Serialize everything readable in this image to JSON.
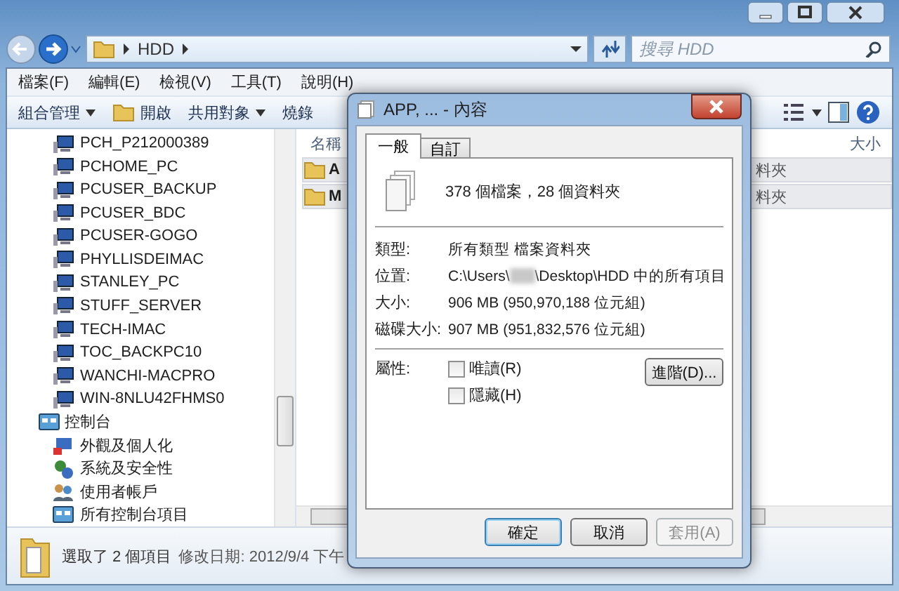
{
  "address_bar": {
    "path": [
      "HDD"
    ]
  },
  "search": {
    "placeholder": "搜尋 HDD"
  },
  "menu": [
    "檔案(F)",
    "編輯(E)",
    "檢視(V)",
    "工具(T)",
    "說明(H)"
  ],
  "toolbar": [
    {
      "label": "組合管理",
      "kind": "dropdown"
    },
    {
      "label": "開啟",
      "kind": "open"
    },
    {
      "label": "共用對象",
      "kind": "dropdown"
    },
    {
      "label": "燒錄",
      "kind": "plain"
    }
  ],
  "sidebar": {
    "items": [
      {
        "label": "PCH_P212000389",
        "kind": "computer"
      },
      {
        "label": "PCHOME_PC",
        "kind": "computer"
      },
      {
        "label": "PCUSER_BACKUP",
        "kind": "computer"
      },
      {
        "label": "PCUSER_BDC",
        "kind": "computer"
      },
      {
        "label": "PCUSER-GOGO",
        "kind": "computer"
      },
      {
        "label": "PHYLLISDEIMAC",
        "kind": "computer"
      },
      {
        "label": "STANLEY_PC",
        "kind": "computer"
      },
      {
        "label": "STUFF_SERVER",
        "kind": "computer"
      },
      {
        "label": "TECH-IMAC",
        "kind": "computer"
      },
      {
        "label": "TOC_BACKPC10",
        "kind": "computer"
      },
      {
        "label": "WANCHI-MACPRO",
        "kind": "computer"
      },
      {
        "label": "WIN-8NLU42FHMS0",
        "kind": "computer"
      },
      {
        "label": "控制台",
        "kind": "panel",
        "children": [
          {
            "label": "外觀及個人化",
            "kind": "appearance"
          },
          {
            "label": "系統及安全性",
            "kind": "system"
          },
          {
            "label": "使用者帳戶",
            "kind": "users"
          },
          {
            "label": "所有控制台項目",
            "kind": "panel"
          }
        ]
      }
    ]
  },
  "file_list": {
    "columns": [
      "名稱",
      "大小"
    ],
    "rows": [
      {
        "name": "A",
        "type": "料夾"
      },
      {
        "name": "M",
        "type": "料夾"
      }
    ]
  },
  "status_bar": {
    "selection": "選取了 2 個項目",
    "modified": "修改日期: 2012/9/4 下午"
  },
  "dialog": {
    "title": "APP, ... - 內容",
    "tabs": [
      {
        "label": "一般",
        "selected": true
      },
      {
        "label": "自訂",
        "selected": false
      }
    ],
    "summary": "378 個檔案，28 個資料夾",
    "fields": [
      {
        "label": "類型:",
        "value": "所有類型 檔案資料夾",
        "kind": "text"
      },
      {
        "label": "位置:",
        "value": "C:\\Users\\",
        "value_end": "\\Desktop\\HDD 中的所有項目",
        "kind": "redacted"
      },
      {
        "label": "大小:",
        "value": "906 MB (950,970,188 位元組)",
        "kind": "text"
      },
      {
        "label": "磁碟大小:",
        "value": "907 MB (951,832,576 位元組)",
        "kind": "text"
      }
    ],
    "attributes": {
      "label": "屬性:",
      "options": [
        {
          "label": "唯讀(R)",
          "checked": false
        },
        {
          "label": "隱藏(H)",
          "checked": false
        }
      ],
      "advanced_button": "進階(D)..."
    },
    "buttons": [
      {
        "label": "確定",
        "kind": "default",
        "disabled": false
      },
      {
        "label": "取消",
        "kind": "normal",
        "disabled": false
      },
      {
        "label": "套用(A)",
        "kind": "normal",
        "disabled": true
      }
    ]
  }
}
